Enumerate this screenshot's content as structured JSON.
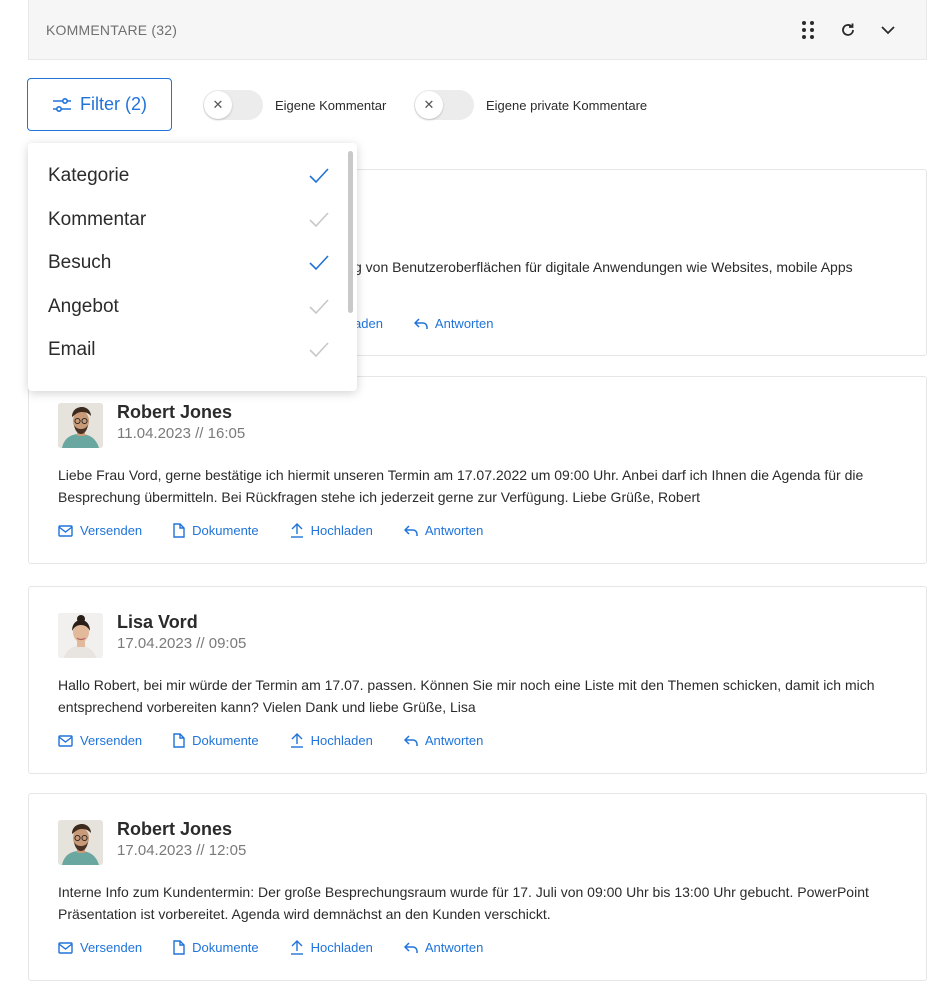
{
  "header": {
    "title": "KOMMENTARE (32)",
    "icons": [
      "drag-dots-icon",
      "refresh-icon",
      "chevron-down-icon"
    ]
  },
  "filter": {
    "label": "Filter (2)"
  },
  "toggles": [
    {
      "label": "Eigene Kommentar",
      "state": "off"
    },
    {
      "label": "Eigene private Kommentare",
      "state": "off"
    }
  ],
  "dropdown": {
    "items": [
      {
        "label": "Kategorie",
        "checked": true
      },
      {
        "label": "Kommentar",
        "checked": false
      },
      {
        "label": "Besuch",
        "checked": true
      },
      {
        "label": "Angebot",
        "checked": false
      },
      {
        "label": "Email",
        "checked": false
      }
    ]
  },
  "actions": {
    "send": "Versenden",
    "docs": "Dokumente",
    "upload": "Hochladen",
    "reply": "Antworten"
  },
  "partial_card": {
    "text_fragment": "g von Benutzeroberflächen für digitale Anwendungen wie Websites, mobile Apps",
    "upload_fragment": "aden",
    "reply": "Antworten"
  },
  "comments": [
    {
      "author": "Robert Jones",
      "date": "11.04.2023 // 16:05",
      "text": "Liebe Frau Vord, gerne bestätige ich hiermit unseren Termin am 17.07.2022 um 09:00 Uhr. Anbei darf ich Ihnen die Agenda für die Besprechung übermitteln. Bei Rückfragen stehe ich jederzeit gerne zur Verfügung. Liebe Grüße, Robert"
    },
    {
      "author": "Lisa Vord",
      "date": "17.04.2023 // 09:05",
      "text": "Hallo Robert, bei mir würde der Termin am 17.07. passen. Können Sie mir noch eine Liste mit den Themen schicken, damit ich mich entsprechend vorbereiten kann? Vielen Dank und liebe Grüße, Lisa"
    },
    {
      "author": "Robert Jones",
      "date": "17.04.2023 // 12:05",
      "text": "Interne Info zum Kundentermin: Der große Besprechungsraum wurde für 17. Juli von 09:00 Uhr bis 13:00 Uhr gebucht. PowerPoint Präsentation ist vorbereitet. Agenda wird demnächst an den Kunden verschickt."
    }
  ],
  "colors": {
    "accent": "#1f73d9",
    "check_active": "#1f73d9",
    "check_inactive": "#c8c8c8"
  }
}
